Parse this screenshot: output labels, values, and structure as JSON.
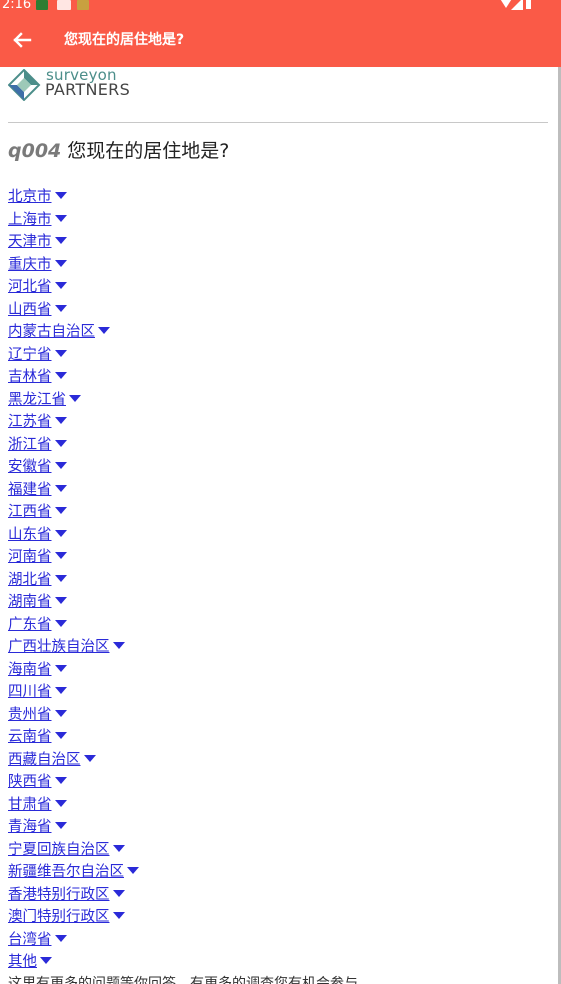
{
  "status_bar": {
    "time": "2:16"
  },
  "app_bar": {
    "title": "您现在的居住地是?"
  },
  "logo": {
    "line1": "surveyon",
    "line2": "PARTNERS"
  },
  "question": {
    "id": "q004",
    "text": "您现在的居住地是?"
  },
  "options": [
    "北京市",
    "上海市",
    "天津市",
    "重庆市",
    "河北省",
    "山西省",
    "内蒙古自治区",
    "辽宁省",
    "吉林省",
    "黑龙江省",
    "江苏省",
    "浙江省",
    "安徽省",
    "福建省",
    "江西省",
    "山东省",
    "河南省",
    "湖北省",
    "湖南省",
    "广东省",
    "广西壮族自治区",
    "海南省",
    "四川省",
    "贵州省",
    "云南省",
    "西藏自治区",
    "陕西省",
    "甘肃省",
    "青海省",
    "宁夏回族自治区",
    "新疆维吾尔自治区",
    "香港特别行政区",
    "澳门特别行政区",
    "台湾省",
    "其他"
  ],
  "footer": {
    "text": "这里有更多的问题等你回答，有更多的调查您有机会参与"
  },
  "colors": {
    "accent": "#fa5a47",
    "link": "#2a2ad8",
    "logo_teal": "#4c8e8a"
  },
  "icons": {
    "back": "arrow-left-icon",
    "option_caret": "caret-down-icon"
  }
}
